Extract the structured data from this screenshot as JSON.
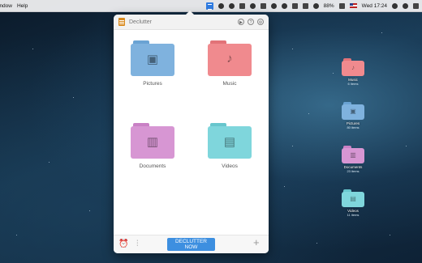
{
  "menubar": {
    "items": [
      "indow",
      "Help"
    ],
    "battery": "88%",
    "clock": "Wed 17:24"
  },
  "popover": {
    "title": "Declutter",
    "buttons": [
      "play",
      "help",
      "settings"
    ],
    "folders": [
      {
        "label": "Pictures",
        "color": "#7fb2de",
        "icon": "image-icon",
        "glyph": "🖼"
      },
      {
        "label": "Music",
        "color": "#f08a8e",
        "icon": "music-note-icon",
        "glyph": "♪"
      },
      {
        "label": "Documents",
        "color": "#d796d3",
        "icon": "book-icon",
        "glyph": "📖"
      },
      {
        "label": "Videos",
        "color": "#7fd6dc",
        "icon": "film-icon",
        "glyph": "🎞"
      }
    ],
    "bottom": {
      "declutter_label": "DECLUTTER NOW"
    }
  },
  "desktop": {
    "folders": [
      {
        "label": "Music",
        "sub": "6 items",
        "color": "#f08a8e"
      },
      {
        "label": "Pictures",
        "sub": "80 items",
        "color": "#7fb2de"
      },
      {
        "label": "Documents",
        "sub": "23 items",
        "color": "#d796d3"
      },
      {
        "label": "Videos",
        "sub": "11 items",
        "color": "#7fd6dc"
      }
    ]
  }
}
